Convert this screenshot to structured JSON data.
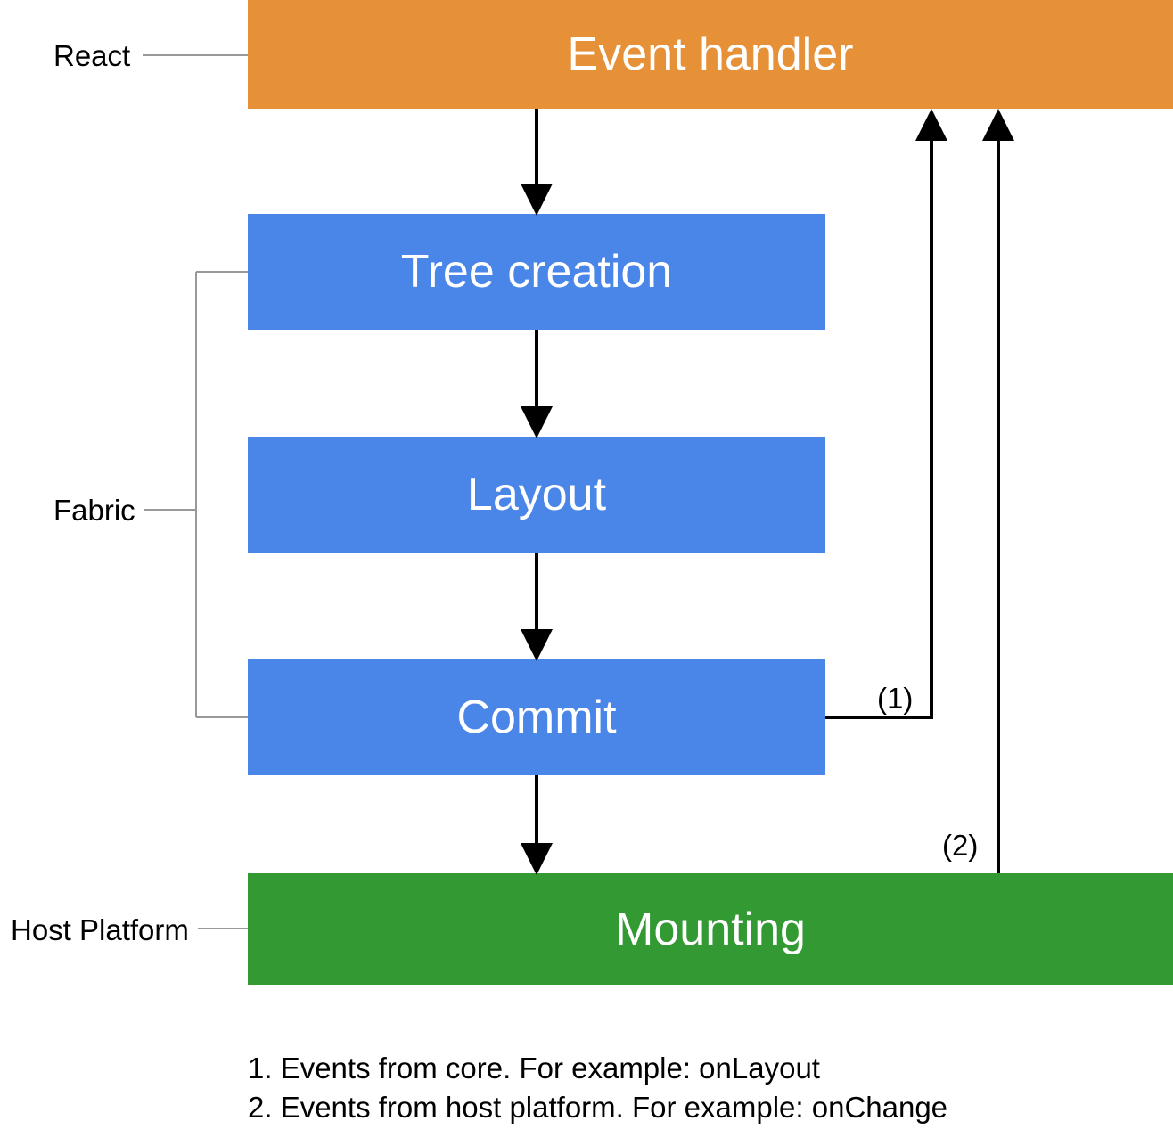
{
  "labels": {
    "react": "React",
    "fabric": "Fabric",
    "host_platform": "Host Platform"
  },
  "boxes": {
    "event_handler": "Event handler",
    "tree_creation": "Tree creation",
    "layout": "Layout",
    "commit": "Commit",
    "mounting": "Mounting"
  },
  "annotations": {
    "one": "(1)",
    "two": "(2)"
  },
  "notes": {
    "line1": "1. Events from core. For example: onLayout",
    "line2": "2. Events from host platform. For example: onChange"
  },
  "colors": {
    "orange": "#e69138",
    "blue": "#4a86e8",
    "green": "#339933",
    "connector": "#999999"
  }
}
